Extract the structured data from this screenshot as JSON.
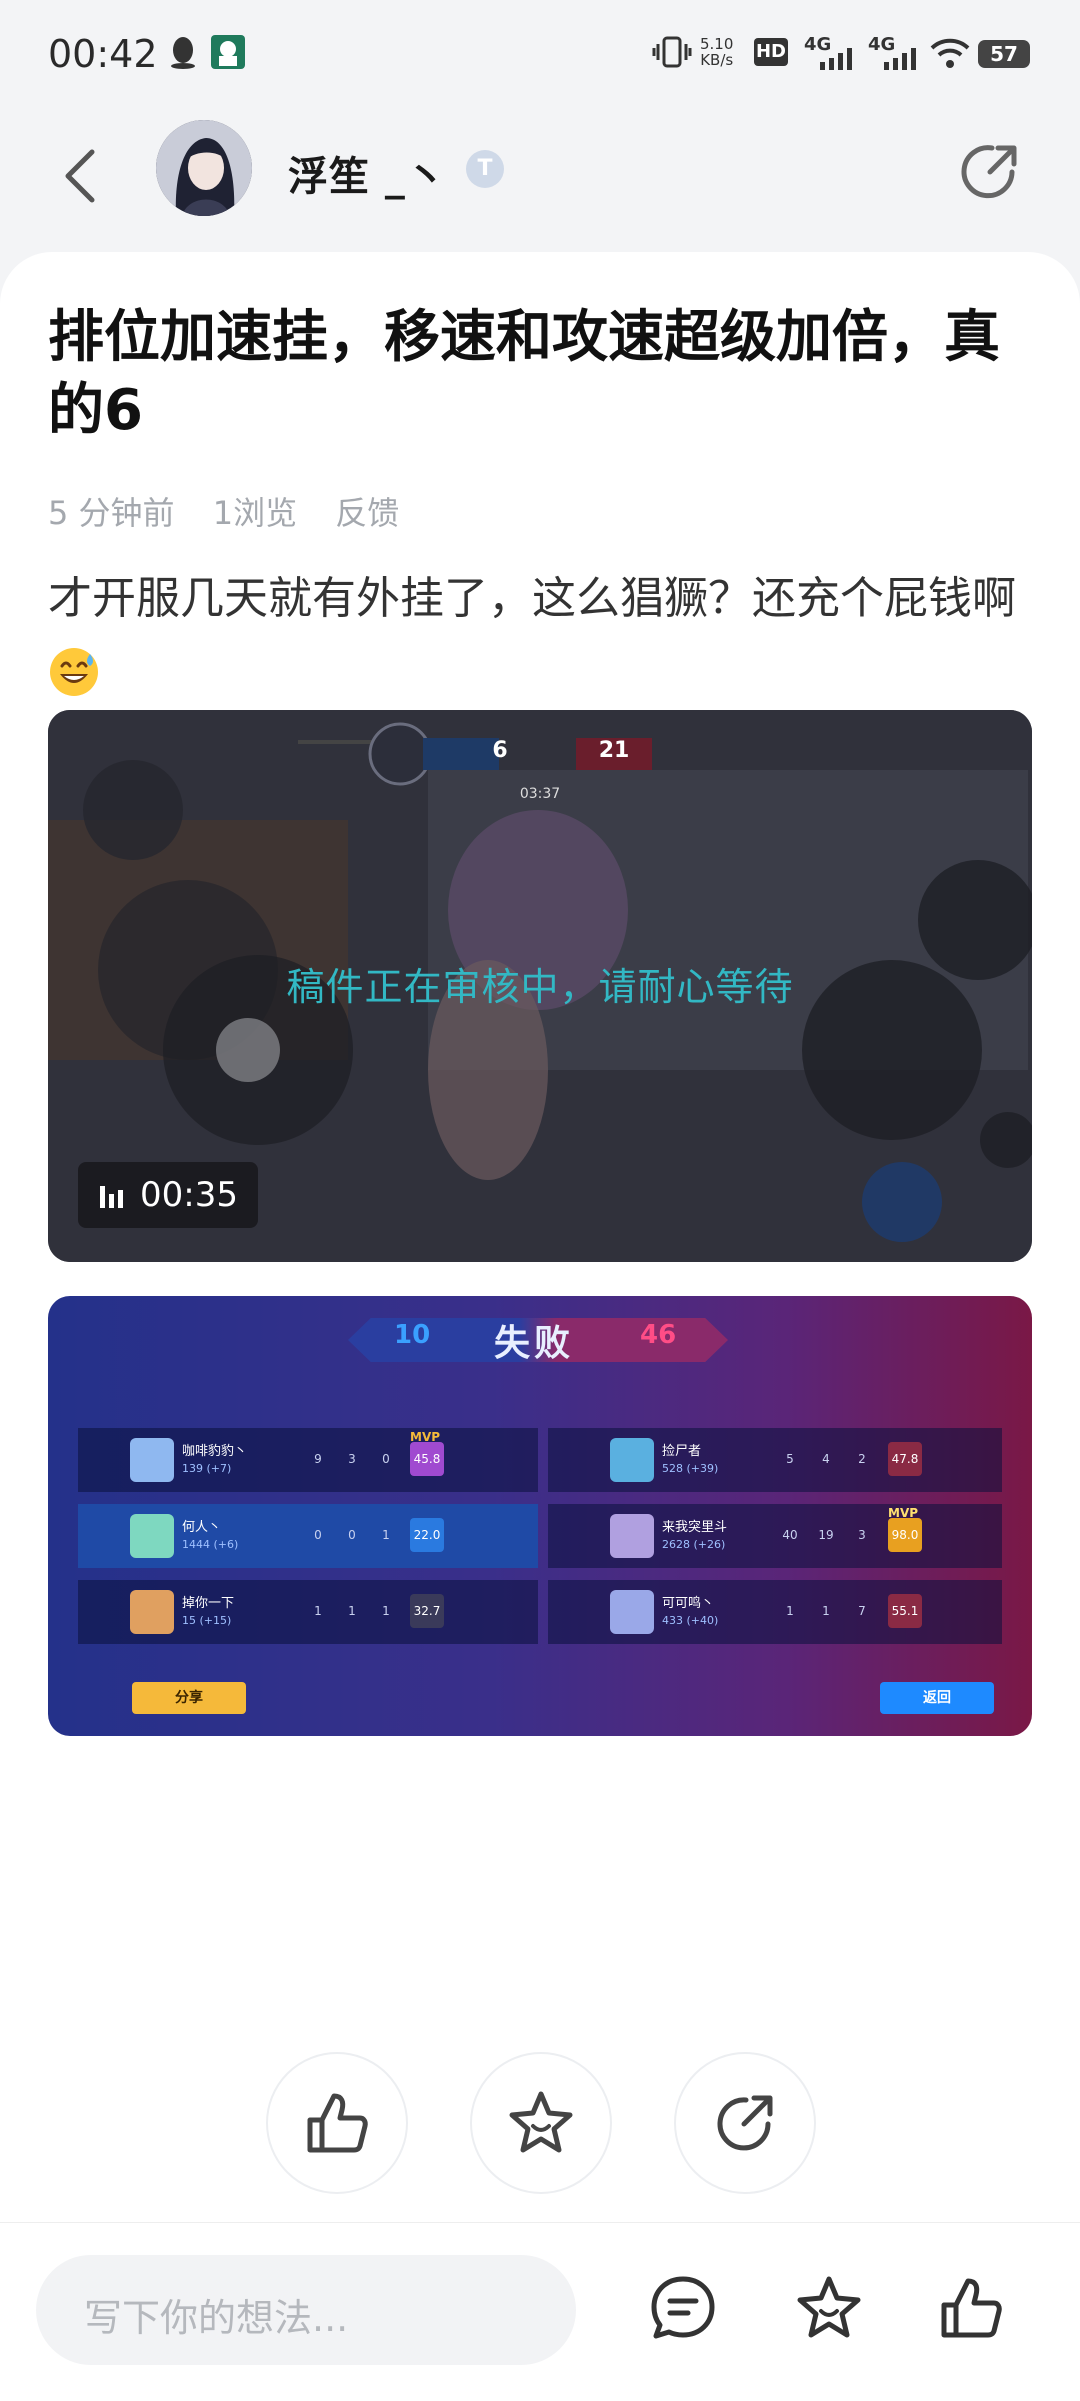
{
  "status_bar": {
    "time": "00:42",
    "net_speed_value": "5.10",
    "net_speed_unit": "KB/s",
    "hd": "HD",
    "net1": "4G",
    "net2": "4G",
    "battery": "57"
  },
  "header": {
    "username": "浮笙 _丶",
    "badge": "T"
  },
  "post": {
    "title": "排位加速挂，移速和攻速超级加倍，真的6",
    "meta": {
      "time": "5 分钟前",
      "views": "1浏览",
      "feedback": "反馈"
    },
    "body": "才开服几天就有外挂了，这么猖獗？还充个屁钱啊",
    "video": {
      "review_text": "稿件正在审核中，请耐心等待",
      "duration": "00:35",
      "score_left": "6",
      "score_right": "21",
      "timer": "03:37"
    },
    "score_image": {
      "result": "失败",
      "left_score": "10",
      "right_score": "46",
      "left": [
        {
          "name": "咖啡豹豹丶",
          "sub": "139 (+7)",
          "k": "9",
          "d": "3",
          "a": "0",
          "rating": "45.8",
          "mvp": "MVP"
        },
        {
          "name": "何人丶",
          "sub": "1444 (+6)",
          "k": "0",
          "d": "0",
          "a": "1",
          "rating": "22.0",
          "mvp": ""
        },
        {
          "name": "掉你一下",
          "sub": "15 (+15)",
          "k": "1",
          "d": "1",
          "a": "1",
          "rating": "32.7",
          "mvp": ""
        }
      ],
      "right": [
        {
          "name": "捡尸者",
          "sub": "528 (+39)",
          "k": "5",
          "d": "4",
          "a": "2",
          "rating": "47.8",
          "mvp": ""
        },
        {
          "name": "来我突里斗",
          "sub": "2628 (+26)",
          "k": "40",
          "d": "19",
          "a": "3",
          "rating": "98.0",
          "mvp": "MVP"
        },
        {
          "name": "可可鸣丶",
          "sub": "433 (+40)",
          "k": "1",
          "d": "1",
          "a": "7",
          "rating": "55.1",
          "mvp": ""
        }
      ],
      "share": "分享",
      "back": "返回"
    }
  },
  "bottom_bar": {
    "placeholder": "写下你的想法..."
  },
  "colors": {
    "accent_teal": "#32b8c4",
    "mvp_gold": "#f5b93a",
    "lose_blue": "#3aa0ff",
    "lose_red": "#ff4d86"
  },
  "icons": [
    "back-icon",
    "share-icon",
    "like-icon",
    "favorite-icon",
    "comment-icon",
    "emoji-sweat-smile"
  ]
}
